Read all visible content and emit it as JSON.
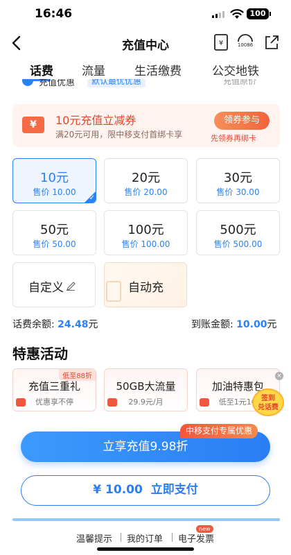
{
  "status_bar": {
    "time": "16:46",
    "battery": "100"
  },
  "nav": {
    "title": "充值中心"
  },
  "tabs": [
    {
      "label": "话费",
      "active": true
    },
    {
      "label": "流量",
      "active": false
    },
    {
      "label": "生活缴费",
      "active": false
    },
    {
      "label": "公交地铁",
      "active": false
    }
  ],
  "option_row": {
    "label": "充值优惠",
    "badge": "默认最优优惠",
    "right": "充值原价"
  },
  "coupon": {
    "icon": "¥",
    "title": "10元充值立减券",
    "subtitle": "满20元可用，限中移支付首绑卡享",
    "button": "领券参与",
    "button_sub": "先领券再绑卡"
  },
  "amounts": [
    {
      "value": "10元",
      "price": "售价 10.00",
      "selected": true
    },
    {
      "value": "20元",
      "price": "售价 20.00",
      "selected": false
    },
    {
      "value": "30元",
      "price": "售价 30.00",
      "selected": false
    },
    {
      "value": "50元",
      "price": "售价 50.00",
      "selected": false
    },
    {
      "value": "100元",
      "price": "售价 100.00",
      "selected": false
    },
    {
      "value": "500元",
      "price": "售价 500.00",
      "selected": false
    }
  ],
  "custom": {
    "label": "自定义"
  },
  "auto": {
    "label": "自动充"
  },
  "balance": {
    "label": "话费余额:",
    "value": "24.48",
    "unit": "元"
  },
  "arrival": {
    "label": "到账金额:",
    "value": "10.00",
    "unit": "元"
  },
  "promo_section": {
    "title": "特惠活动",
    "items": [
      {
        "title": "充值三重礼",
        "sub": "优惠享不停",
        "tag": "低至88折"
      },
      {
        "title": "50GB大流量",
        "sub": "29.9元/月",
        "tag": ""
      },
      {
        "title": "加油特惠包",
        "sub": "低至1元1G",
        "tag": ""
      }
    ],
    "signin_badge": [
      "签到",
      "兑话费"
    ]
  },
  "exclusive_tag": "中移支付专属优惠",
  "main_button": "立享充值9.98折",
  "pay_button": {
    "currency": "¥",
    "amount": "10.00",
    "label": "立即支付"
  },
  "footer": {
    "links": [
      "温馨提示",
      "我的订单",
      "电子发票"
    ],
    "new_badge": "new"
  },
  "colors": {
    "accent": "#2a82f6",
    "promo": "#e4462c"
  }
}
